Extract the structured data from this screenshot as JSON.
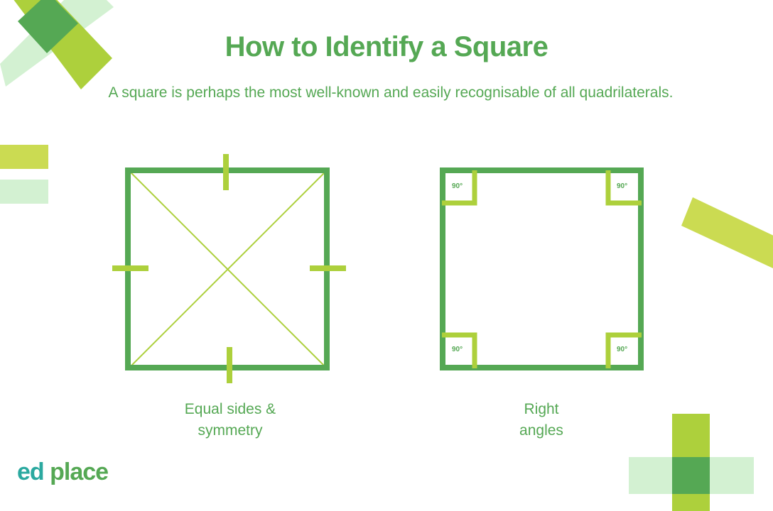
{
  "title": "How to Identify a Square",
  "subtitle": "A square is perhaps the most well-known and easily recognisable of all quadrilaterals.",
  "colors": {
    "dark_green": "#55A854",
    "lime": "#ADD03C",
    "yellow_green": "#CBDB52",
    "mint": "#D3F1D2",
    "teal": "#2BA9A0"
  },
  "diagrams": [
    {
      "name": "equal-sides-square",
      "caption_line1": "Equal sides &",
      "caption_line2": "symmetry",
      "features": [
        "four equal-length tick marks",
        "two diagonals"
      ]
    },
    {
      "name": "right-angles-square",
      "caption_line1": "Right",
      "caption_line2": "angles",
      "angle_labels": [
        "90°",
        "90°",
        "90°",
        "90°"
      ]
    }
  ],
  "logo": {
    "part1": "ed",
    "part2": "place"
  }
}
